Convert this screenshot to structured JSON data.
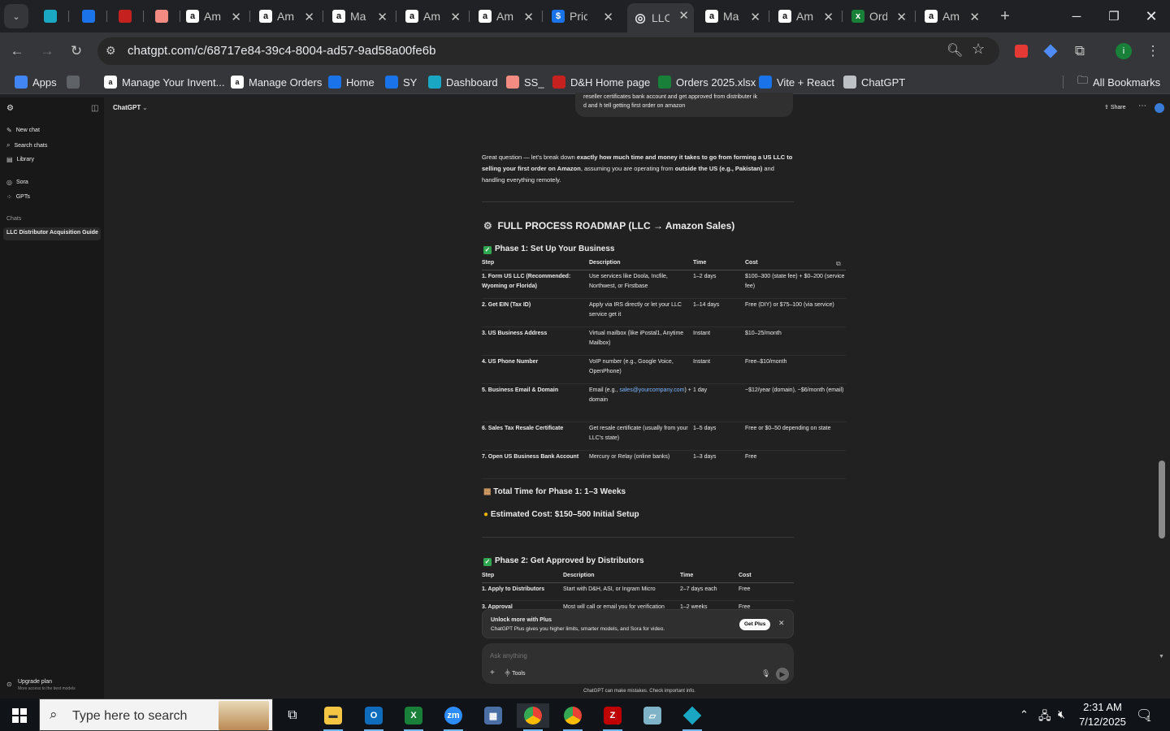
{
  "tabs": [
    {
      "title": "",
      "icon": "diamond-icon",
      "color": "#1aa7c4"
    },
    {
      "title": "",
      "icon": "ec-icon",
      "color": "#1a73e8",
      "badge": "EC"
    },
    {
      "title": "",
      "icon": "dh-icon",
      "color": "#c5221f",
      "badge": "D&H"
    },
    {
      "title": "",
      "icon": "stack-icon",
      "color": "#f28b82"
    },
    {
      "title": "Am",
      "icon": "amazon-icon",
      "color": "#f2f2f2"
    },
    {
      "title": "Am",
      "icon": "amazon-icon",
      "color": "#f2f2f2"
    },
    {
      "title": "Ma",
      "icon": "amazon-icon",
      "color": "#f2f2f2"
    },
    {
      "title": "Am",
      "icon": "amazon-icon",
      "color": "#f2f2f2"
    },
    {
      "title": "Am",
      "icon": "amazon-icon",
      "color": "#f2f2f2"
    },
    {
      "title": "Pric",
      "icon": "dollar-icon",
      "color": "#1a73e8"
    },
    {
      "title": "LLC",
      "icon": "chatgpt-icon",
      "color": "#e8eaed",
      "active": true
    },
    {
      "title": "Ma",
      "icon": "amazon-icon",
      "color": "#f2f2f2"
    },
    {
      "title": "Am",
      "icon": "amazon-icon",
      "color": "#f2f2f2"
    },
    {
      "title": "Ord",
      "icon": "excel-icon",
      "color": "#188038"
    },
    {
      "title": "Am",
      "icon": "amazon-icon",
      "color": "#f2f2f2"
    }
  ],
  "browser": {
    "url": "chatgpt.com/c/68717e84-39c4-8004-ad57-9ad58a00fe6b",
    "profile_initial": "i",
    "bookmarks": [
      {
        "label": "Apps",
        "icon": "apps-grid-icon"
      },
      {
        "label": "",
        "icon": "tab-groups-icon"
      },
      {
        "label": "Manage Your Invent...",
        "icon": "amazon-icon"
      },
      {
        "label": "Manage Orders",
        "icon": "amazon-icon"
      },
      {
        "label": "Home",
        "icon": "home-icon"
      },
      {
        "label": "SY",
        "icon": "ec-icon"
      },
      {
        "label": "Dashboard",
        "icon": "diamond-icon"
      },
      {
        "label": "SS_",
        "icon": "stack-icon"
      },
      {
        "label": "D&H Home page",
        "icon": "dh-icon"
      },
      {
        "label": "Orders 2025.xlsx",
        "icon": "excel-icon"
      },
      {
        "label": "Vite + React",
        "icon": "dollar-icon"
      },
      {
        "label": "ChatGPT",
        "icon": "chatgpt-icon"
      }
    ],
    "all_bookmarks": "All Bookmarks"
  },
  "sidebar": {
    "items": [
      {
        "label": "New chat",
        "icon": "compose-icon"
      },
      {
        "label": "Search chats",
        "icon": "search-icon"
      },
      {
        "label": "Library",
        "icon": "library-icon"
      },
      {
        "label": "Sora",
        "icon": "sora-icon"
      },
      {
        "label": "GPTs",
        "icon": "gpts-icon"
      }
    ],
    "chats_heading": "Chats",
    "chats": [
      "LLC Distributor Acquisition Guide"
    ],
    "upgrade_title": "Upgrade plan",
    "upgrade_sub": "More access to the best models"
  },
  "header": {
    "model": "ChatGPT",
    "share": "Share"
  },
  "chat": {
    "user_bubble_line1": "reseller certificates  bank account and get approved from distributer ik",
    "user_bubble_line2": "d and h  tell getting first order on amazon",
    "intro_1": "Great question — let's break down ",
    "intro_bold_1": "exactly how much time and money it takes to go from forming a US LLC to selling your first order on Amazon",
    "intro_2": ", assuming you are operating from ",
    "intro_bold_2": "outside the US (e.g., Pakistan)",
    "intro_3": " and handling everything remotely.",
    "roadmap_title": "FULL PROCESS ROADMAP (LLC → Amazon Sales)",
    "phase1_title": "Phase 1: Set Up Your Business",
    "table_headers": [
      "Step",
      "Description",
      "Time",
      "Cost"
    ],
    "phase1_rows": [
      [
        "1. Form US LLC (Recommended: Wyoming or Florida)",
        "Use services like Doola, Incfile, Northwest, or Firstbase",
        "1–2 days",
        "$100–300 (state fee) + $0–200 (service fee)"
      ],
      [
        "2. Get EIN (Tax ID)",
        "Apply via IRS directly or let your LLC service get it",
        "1–14 days",
        "Free (DIY) or $75–100 (via service)"
      ],
      [
        "3. US Business Address",
        "Virtual mailbox (like iPostal1, Anytime Mailbox)",
        "Instant",
        "$10–25/month"
      ],
      [
        "4. US Phone Number",
        "VoIP number (e.g., Google Voice, OpenPhone)",
        "Instant",
        "Free–$10/month"
      ],
      [
        "5. Business Email & Domain",
        "Email (e.g., sales@yourcompany.com) + domain",
        "1 day",
        "~$12/year (domain), ~$6/month (email)"
      ],
      [
        "6. Sales Tax Resale Certificate",
        "Get resale certificate (usually from your LLC's state)",
        "1–5 days",
        "Free or $0–50 depending on state"
      ],
      [
        "7. Open US Business Bank Account",
        "Mercury or Relay (online banks)",
        "1–3 days",
        "Free"
      ]
    ],
    "phase1_total_time": "Total Time for Phase 1: 1–3 Weeks",
    "phase1_total_cost": "Estimated Cost: $150–500 Initial Setup",
    "phase2_title": "Phase 2: Get Approved by Distributors",
    "phase2_rows": [
      [
        "1. Apply to Distributors",
        "Start with D&H, ASI, or Ingram Micro",
        "2–7 days each",
        "Free"
      ],
      [
        "3. Approval",
        "Most will call or email you for verification",
        "1–2 weeks",
        "Free"
      ]
    ]
  },
  "upsell": {
    "title": "Unlock more with Plus",
    "subtitle": "ChatGPT Plus gives you higher limits, smarter models, and Sora for video.",
    "button": "Get Plus"
  },
  "composer": {
    "placeholder": "Ask anything",
    "tools": "Tools",
    "disclaimer": "ChatGPT can make mistakes. Check important info."
  },
  "taskbar": {
    "search_placeholder": "Type here to search",
    "time": "2:31 AM",
    "date": "7/12/2025",
    "notification_count": "1"
  }
}
